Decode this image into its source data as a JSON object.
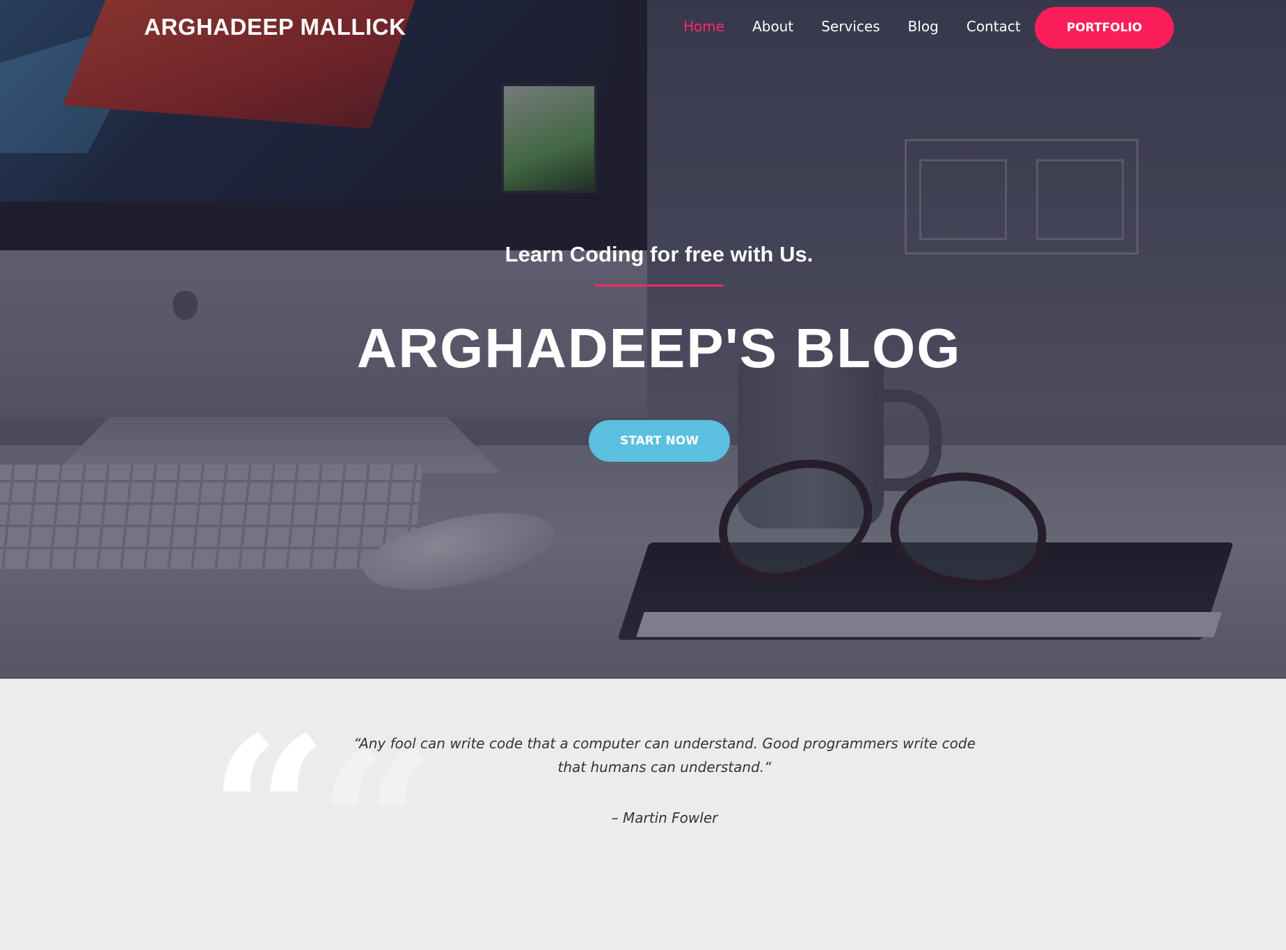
{
  "nav": {
    "brand": "ARGHADEEP MALLICK",
    "links": [
      "Home",
      "About",
      "Services",
      "Blog",
      "Contact"
    ],
    "active_link": "Home",
    "cta": "PORTFOLIO"
  },
  "hero": {
    "tagline": "Learn Coding for free with Us.",
    "title": "ARGHADEEP'S BLOG",
    "cta": "START NOW"
  },
  "quote": {
    "text": "“Any fool can write code that a computer can understand. Good programmers write code that humans can understand.“",
    "author": "– Martin Fowler",
    "quote_icon": "quote-icon"
  },
  "colors": {
    "accent_pink": "#fa1e5a",
    "accent_blue": "#5bbfe0",
    "section_bg": "#ececec"
  }
}
